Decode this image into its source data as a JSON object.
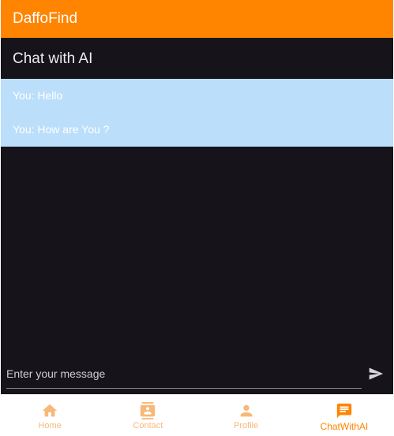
{
  "app": {
    "title": "DaffoFind",
    "accent_color": "#ff8500",
    "background_color": "#16141a",
    "chat_list_color": "#bbdefb"
  },
  "page": {
    "title": "Chat with AI"
  },
  "chat": {
    "messages": [
      {
        "text": "You: Hello"
      },
      {
        "text": "You: How are You ?"
      }
    ]
  },
  "composer": {
    "placeholder": "Enter your message",
    "value": "",
    "send_icon": "send-icon"
  },
  "bottom_nav": {
    "items": [
      {
        "label": "Home",
        "icon": "home-icon",
        "active": false
      },
      {
        "label": "Contact",
        "icon": "contact-icon",
        "active": false
      },
      {
        "label": "Profile",
        "icon": "person-icon",
        "active": false
      },
      {
        "label": "ChatWithAI",
        "icon": "chat-icon",
        "active": true
      }
    ]
  }
}
